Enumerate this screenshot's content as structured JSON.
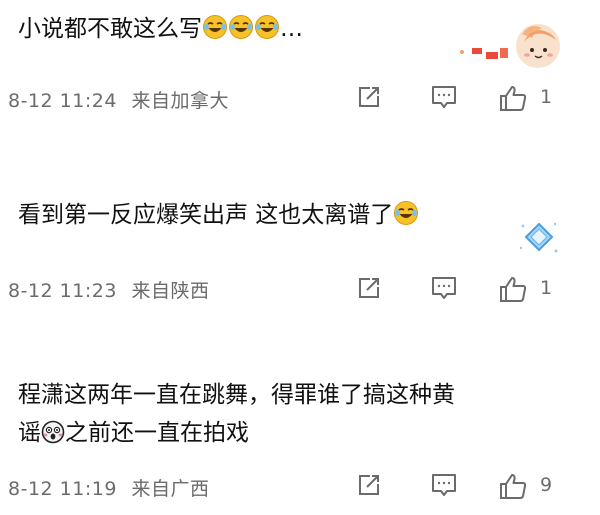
{
  "comments": [
    {
      "text_parts": [
        "小说都不敢这么写",
        "…"
      ],
      "time": "8-12 11:24",
      "location": "来自加拿大",
      "likes": "1",
      "emoji": "laugh-cry",
      "emoji_count": 3
    },
    {
      "text_parts": [
        "看到第一反应爆笑出声 这也太离谱了"
      ],
      "time": "8-12 11:23",
      "location": "来自陕西",
      "likes": "1",
      "emoji": "laugh-cry",
      "emoji_count": 1
    },
    {
      "text_parts": [
        "程潇这两年一直在跳舞，得罪谁了搞这种黄",
        "之前还一直在拍戏",
        "谣"
      ],
      "time": "8-12 11:19",
      "location": "来自广西",
      "likes": "9",
      "emoji": "shock",
      "emoji_count": 1
    }
  ],
  "colors": {
    "text": "#111111",
    "meta": "#6b6b6b",
    "icon": "#6b6b6b"
  },
  "icons": [
    "repost-icon",
    "comment-icon",
    "thumbs-up-icon",
    "peach-sticker-icon",
    "diamond-badge-icon"
  ]
}
